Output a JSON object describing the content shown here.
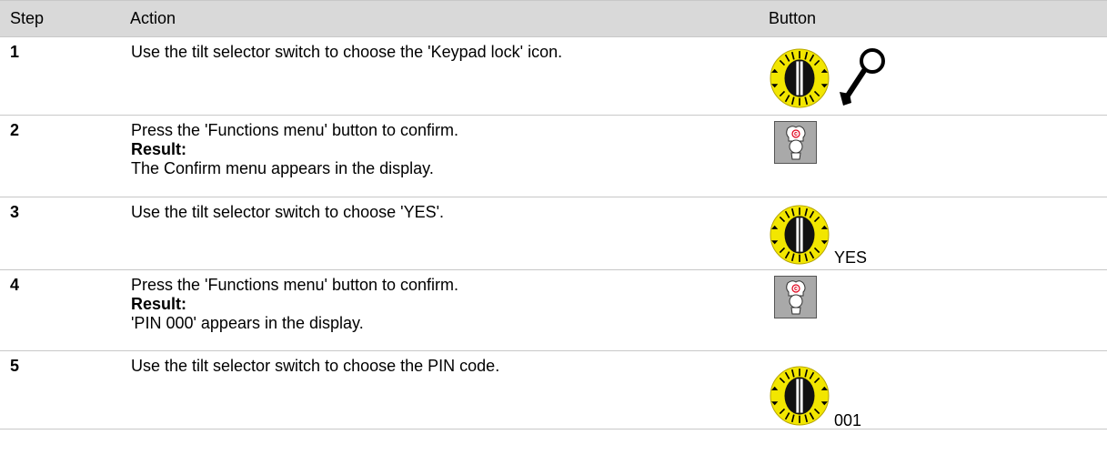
{
  "header": {
    "step": "Step",
    "action": "Action",
    "button": "Button"
  },
  "rows": [
    {
      "step": "1",
      "action": "Use the tilt selector switch to choose the 'Keypad lock' icon.",
      "button": {
        "type": "tilt-switch",
        "icon": "key-icon"
      }
    },
    {
      "step": "2",
      "action": "Press the 'Functions menu' button to confirm.",
      "result_label": "Result:",
      "result_text": "The Confirm menu appears in the display.",
      "button": {
        "type": "functions-menu-button",
        "badge": "c"
      }
    },
    {
      "step": "3",
      "action": "Use the tilt selector switch to choose 'YES'.",
      "button": {
        "type": "tilt-switch",
        "value": "YES"
      }
    },
    {
      "step": "4",
      "action": "Press the 'Functions menu' button to confirm.",
      "result_label": "Result:",
      "result_text": "'PIN 000' appears in the display.",
      "button": {
        "type": "functions-menu-button",
        "badge": "c"
      }
    },
    {
      "step": "5",
      "action": "Use the tilt selector switch to choose the PIN code.",
      "button": {
        "type": "tilt-switch",
        "value": "001"
      }
    }
  ],
  "colors": {
    "header_bg": "#d9d9d9",
    "switch_yellow": "#f2e600",
    "menu_button_bg": "#a9a9a9",
    "badge_red": "#e0001a"
  }
}
